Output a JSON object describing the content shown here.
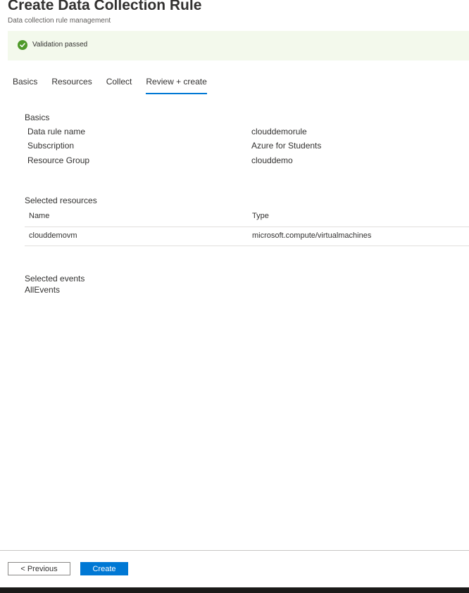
{
  "header": {
    "title": "Create Data Collection Rule",
    "subtitle": "Data collection rule management"
  },
  "banner": {
    "text": "Validation passed",
    "status_color": "#4f9a2a",
    "icon": "check-circle-icon"
  },
  "tabs": [
    {
      "label": "Basics",
      "active": false
    },
    {
      "label": "Resources",
      "active": false
    },
    {
      "label": "Collect",
      "active": false
    },
    {
      "label": "Review + create",
      "active": true
    }
  ],
  "basics": {
    "title": "Basics",
    "rows": [
      {
        "label": "Data rule name",
        "value": "clouddemorule"
      },
      {
        "label": "Subscription",
        "value": "Azure for Students"
      },
      {
        "label": "Resource Group",
        "value": "clouddemo"
      }
    ]
  },
  "resources": {
    "title": "Selected resources",
    "columns": [
      "Name",
      "Type"
    ],
    "rows": [
      {
        "name": "clouddemovm",
        "type": "microsoft.compute/virtualmachines"
      }
    ]
  },
  "events": {
    "title": "Selected events",
    "value": "AllEvents"
  },
  "footer": {
    "previous_label": "< Previous",
    "create_label": "Create",
    "accent_color": "#0078d4"
  }
}
